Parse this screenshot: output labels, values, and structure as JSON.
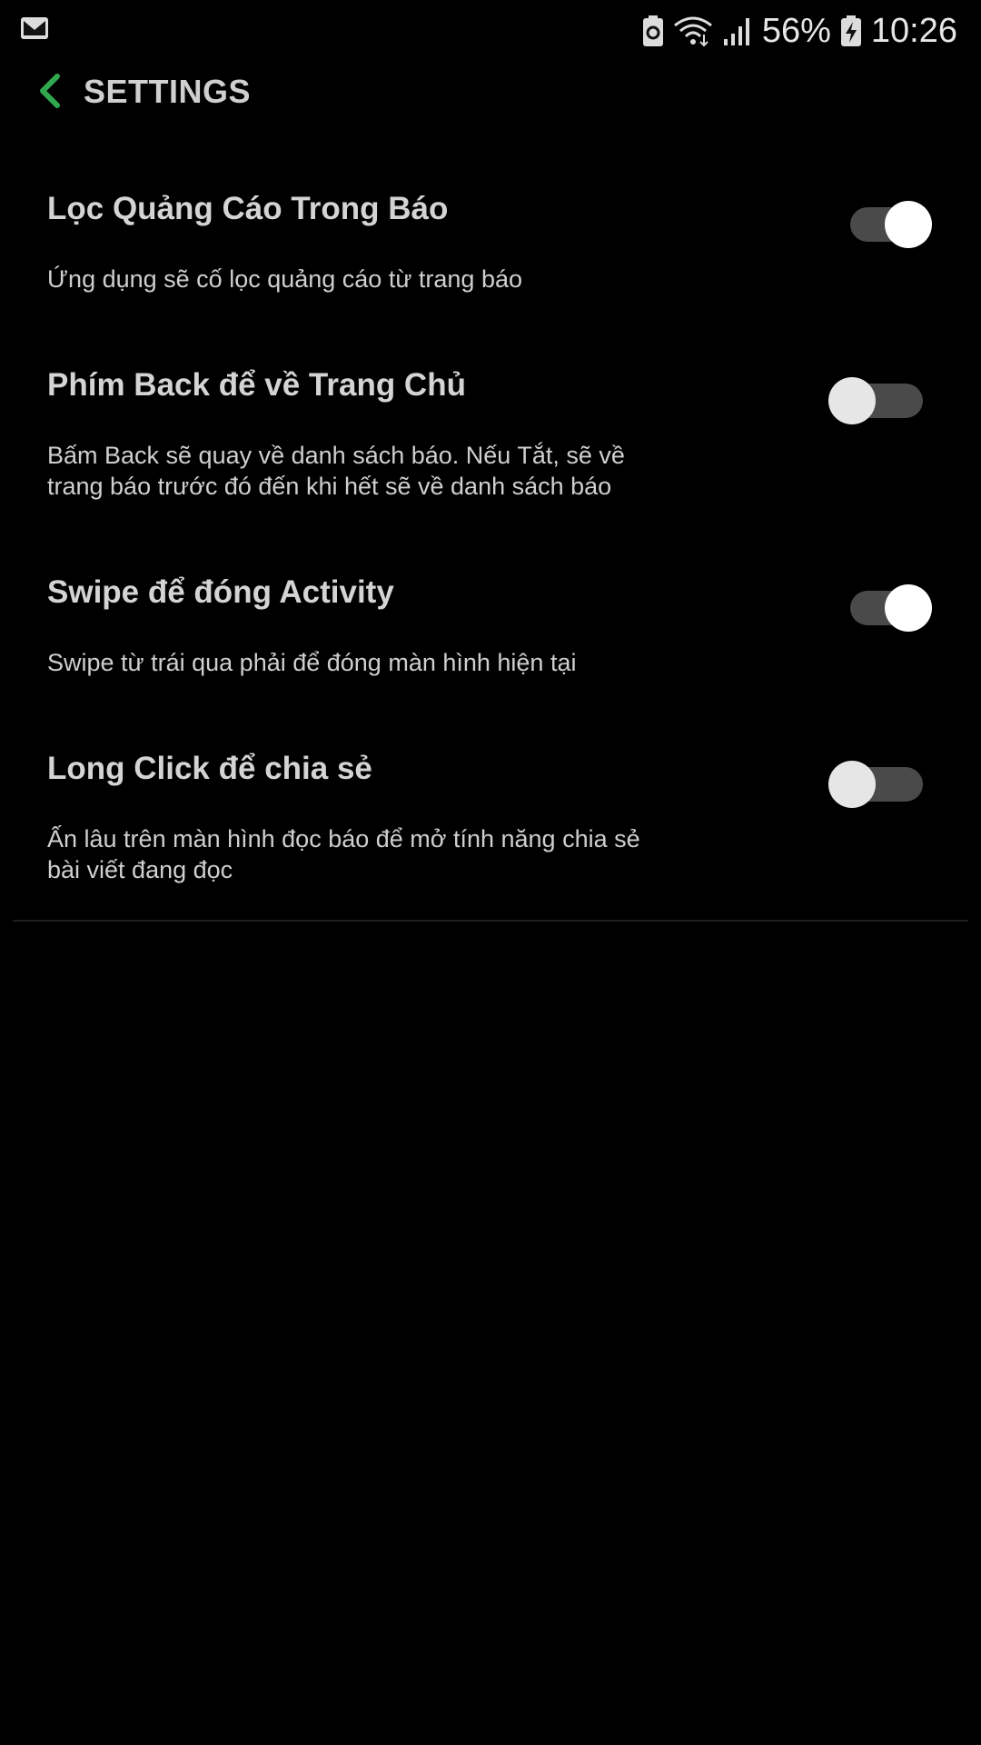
{
  "status_bar": {
    "battery_percent": "56%",
    "time": "10:26",
    "icons": [
      "mail-icon",
      "battery-saver-icon",
      "wifi-icon",
      "signal-icon",
      "battery-charging-icon"
    ]
  },
  "app_bar": {
    "title": "SETTINGS",
    "back_icon": "chevron-left-icon",
    "accent_color": "#2fa84f"
  },
  "settings": [
    {
      "title": "Lọc Quảng Cáo Trong Báo",
      "description": [
        "Ứng dụng sẽ cố lọc quảng cáo từ trang báo"
      ],
      "enabled": true
    },
    {
      "title": "Phím Back để về Trang Chủ",
      "description": [
        "Bấm Back sẽ quay về danh sách báo. Nếu Tắt, sẽ về",
        "trang báo trước đó đến khi hết sẽ về danh sách báo"
      ],
      "enabled": false
    },
    {
      "title": "Swipe để đóng Activity",
      "description": [
        "Swipe từ trái qua phải để đóng màn hình hiện tại"
      ],
      "enabled": true
    },
    {
      "title": "Long Click để chia sẻ",
      "description": [
        "Ấn lâu trên màn hình đọc báo để mở tính năng chia sẻ",
        "bài viết đang đọc"
      ],
      "enabled": false
    }
  ]
}
